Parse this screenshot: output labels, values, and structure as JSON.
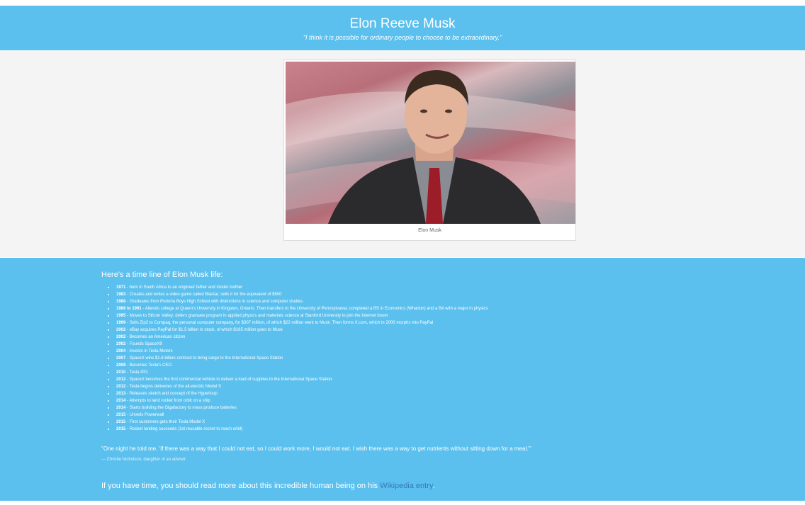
{
  "header": {
    "title": "Elon Reeve Musk",
    "quote": "\"I think it is possible for ordinary people to choose to be extraordinary.\""
  },
  "figure": {
    "image_alt": "Elon Musk",
    "caption": "Elon Musk"
  },
  "timeline": {
    "heading": "Here's a time line of Elon Musk life:",
    "items": [
      {
        "year": "1971",
        "text": " - born in South Africa to an engineer father and model mother"
      },
      {
        "year": "1983",
        "text": " - Creates and writes a video game called Blastar; sells it for the equivalent of $500"
      },
      {
        "year": "1988",
        "text": " - Graduates from Pretoria Boys High School with distinctions in science and computer studies"
      },
      {
        "year": "1989 to 1991",
        "text": " - Attends college at Queen's University in Kingston, Ontario. Then transfers to the University of Pennsylvania; completed a BS in Economics (Wharton) and a BA with a major in physics"
      },
      {
        "year": "1995",
        "text": " - Moves to Silicon Valley; defers graduate program in applied physics and materials science at Stanford University to join the Internet boom"
      },
      {
        "year": "1999",
        "text": " - Sells Zip2 to Compaq, the personal computer company, for $307 million, of which $22 million went to Musk. Then forms X.com, which in 2000 morphs into PayPal"
      },
      {
        "year": "2002",
        "text": " - eBay acquires PayPal for $1.5 billion in stock, of which $165 million goes to Musk"
      },
      {
        "year": "2002",
        "text": " - Becomes an American citizen"
      },
      {
        "year": "2002",
        "text": " - Founds SpaceX9"
      },
      {
        "year": "2004",
        "text": " - Invests in Tesla Motors"
      },
      {
        "year": "2007",
        "text": " - SpaceX wins $1.6 billion contract to bring cargo to the International Space Station"
      },
      {
        "year": "2008",
        "text": " - Becomes Tesla's CEO"
      },
      {
        "year": "2010",
        "text": " - Tesla IPO"
      },
      {
        "year": "2012",
        "text": " - SpaceX becomes the first commercial vehicle to deliver a load of supplies to the International Space Station."
      },
      {
        "year": "2012",
        "text": " - Tesla begins deliveries of the all-electric Model S"
      },
      {
        "year": "2013",
        "text": " - Releases sketch and concept of the Hyperloop"
      },
      {
        "year": "2014",
        "text": " - Attempts to land rocket from orbit on a ship"
      },
      {
        "year": "2014",
        "text": " - Starts building the Gigafactory to mass produce batteries"
      },
      {
        "year": "2015",
        "text": " - Unveils Powerwall"
      },
      {
        "year": "2015",
        "text": " - First customers gets their Tesla Model X"
      },
      {
        "year": "2015",
        "text": " - Rocket landing succeeds (1st reusable rocket to reach orbit)"
      }
    ]
  },
  "blockquote": {
    "text": "\"One night he told me, 'If there was a way that I could not eat, so I could work more, I would not eat. I wish there was a way to get nutrients without sitting down for a meal.'\"",
    "attribution": "— Christie Nicholson, daughter of an advisor"
  },
  "more": {
    "text": "If you have time, you should read more about this incredible human being on his ",
    "link_label": "Wikipedia entry",
    "after": "."
  },
  "colors": {
    "accent": "#5bc0ee",
    "link": "#337ab7",
    "hero_bg": "#f4f4f4"
  }
}
